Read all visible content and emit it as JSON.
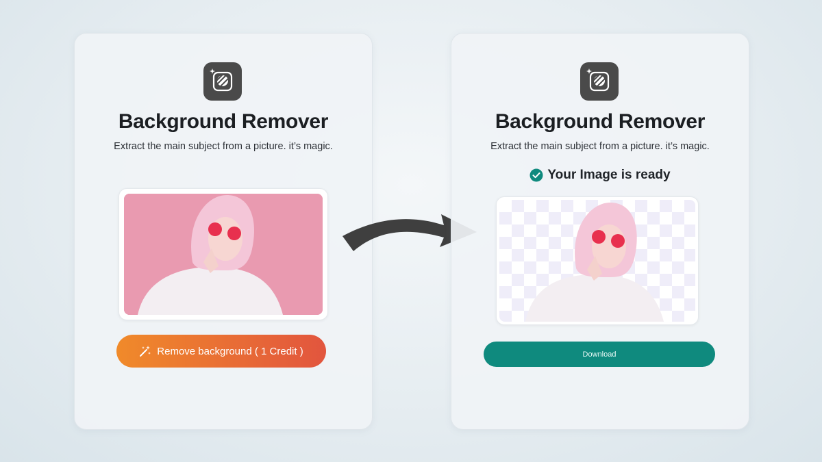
{
  "left_card": {
    "title": "Background Remover",
    "subtitle": "Extract the main subject from a picture. it’s magic.",
    "app_icon": "background-remover-icon",
    "image_background": "#e99ab0",
    "button": {
      "label": "Remove background ( 1 Credit )",
      "icon": "magic-wand-icon",
      "gradient_start": "#f08a2a",
      "gradient_end": "#e2553e"
    }
  },
  "right_card": {
    "title": "Background Remover",
    "subtitle": "Extract the main subject from a picture. it’s magic.",
    "app_icon": "background-remover-icon",
    "status": {
      "icon": "check-circle-icon",
      "text": "Your Image is ready",
      "color": "#0f8a7e"
    },
    "button": {
      "label": "Download",
      "color": "#0f8a7e"
    }
  },
  "colors": {
    "accent": "#0f8a7e",
    "text": "#1b1e22",
    "icon_bg": "#4a4a4a"
  }
}
